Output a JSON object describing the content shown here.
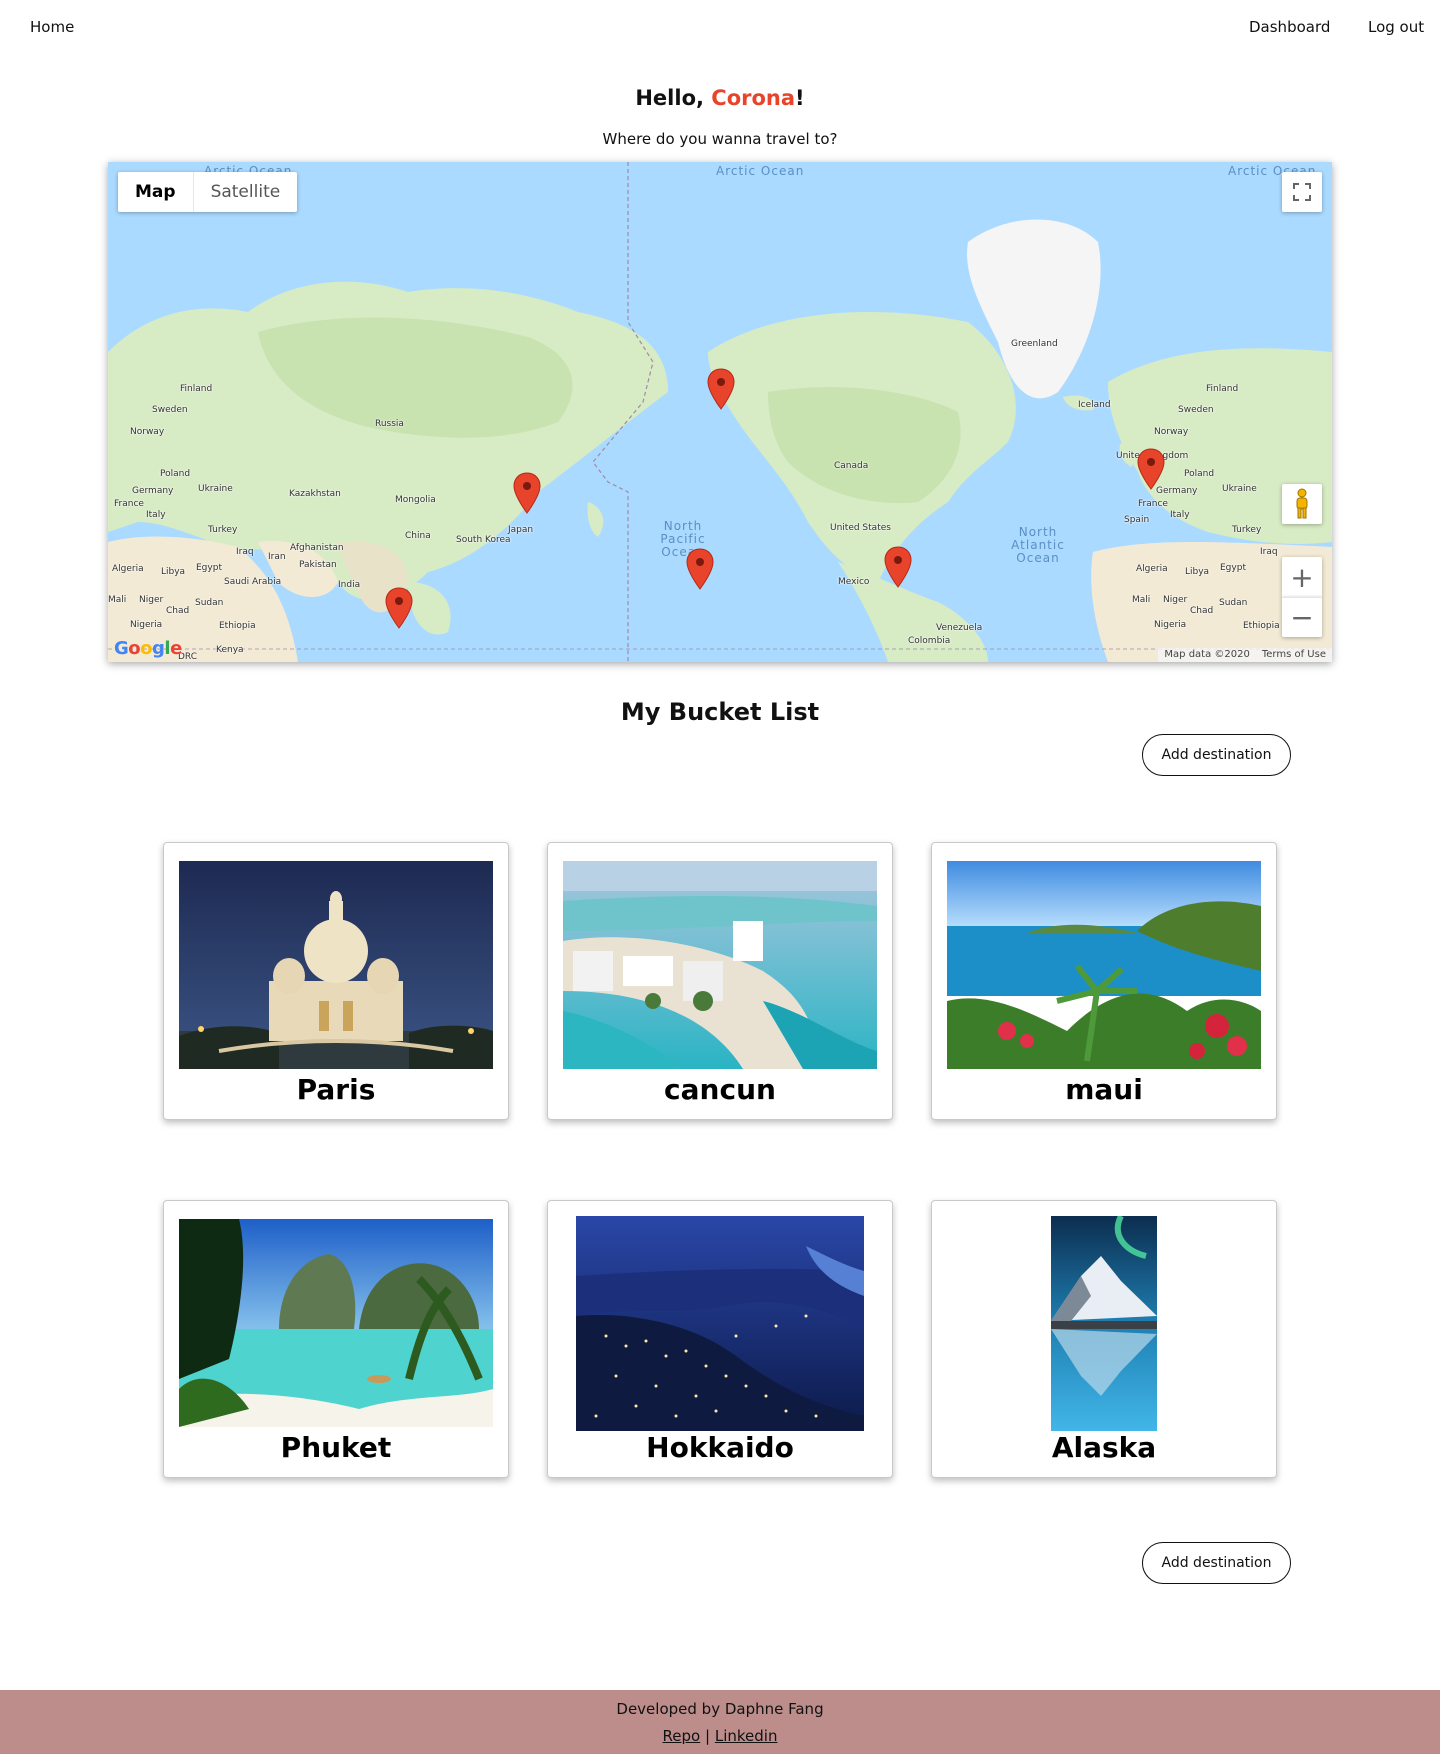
{
  "nav": {
    "home": "Home",
    "dashboard": "Dashboard",
    "logout": "Log out"
  },
  "greeting": {
    "prefix": "Hello, ",
    "name": "Corona",
    "suffix": "!"
  },
  "subtitle": "Where do you wanna travel to?",
  "map": {
    "type_map": "Map",
    "type_satellite": "Satellite",
    "ocean_labels": [
      "Arctic Ocean",
      "Arctic Ocean",
      "Arctic Ocean",
      "North Pacific Ocean",
      "North Atlantic Ocean"
    ],
    "places": [
      "Finland",
      "Sweden",
      "Norway",
      "Russia",
      "Poland",
      "Germany",
      "Ukraine",
      "France",
      "Italy",
      "Kazakhstan",
      "Mongolia",
      "China",
      "Turkey",
      "Iraq",
      "Iran",
      "Afghanistan",
      "Pakistan",
      "India",
      "Egypt",
      "Libya",
      "Algeria",
      "Saudi Arabia",
      "Mali",
      "Niger",
      "Chad",
      "Sudan",
      "Nigeria",
      "Ethiopia",
      "Kenya",
      "DRC",
      "South Korea",
      "Japan",
      "Greenland",
      "Iceland",
      "Canada",
      "United States",
      "Mexico",
      "Venezuela",
      "Colombia",
      "Spain",
      "Finland",
      "Sweden",
      "Norway",
      "Poland",
      "Germany",
      "Ukraine",
      "France",
      "Italy",
      "Turkey",
      "Iraq",
      "Egypt",
      "Libya",
      "Algeria",
      "Mali",
      "Niger",
      "Chad",
      "Sudan",
      "Nigeria",
      "Ethiopia",
      "United Kingdom"
    ],
    "attribution": "Map data ©2020",
    "terms": "Terms of Use",
    "logo": "Google",
    "zoom_in": "+",
    "zoom_out": "−",
    "marker_color": "#e8432b"
  },
  "bucket": {
    "title": "My Bucket List",
    "add_label": "Add destination",
    "destinations": [
      {
        "name": "Paris"
      },
      {
        "name": "cancun"
      },
      {
        "name": "maui"
      },
      {
        "name": "Phuket"
      },
      {
        "name": "Hokkaido"
      },
      {
        "name": "Alaska"
      }
    ]
  },
  "footer": {
    "credit": "Developed by Daphne Fang",
    "repo": "Repo",
    "separator": "|",
    "linkedin": "Linkedin",
    "background": "#bc8d8b"
  },
  "colors": {
    "accent": "#e8432b"
  }
}
